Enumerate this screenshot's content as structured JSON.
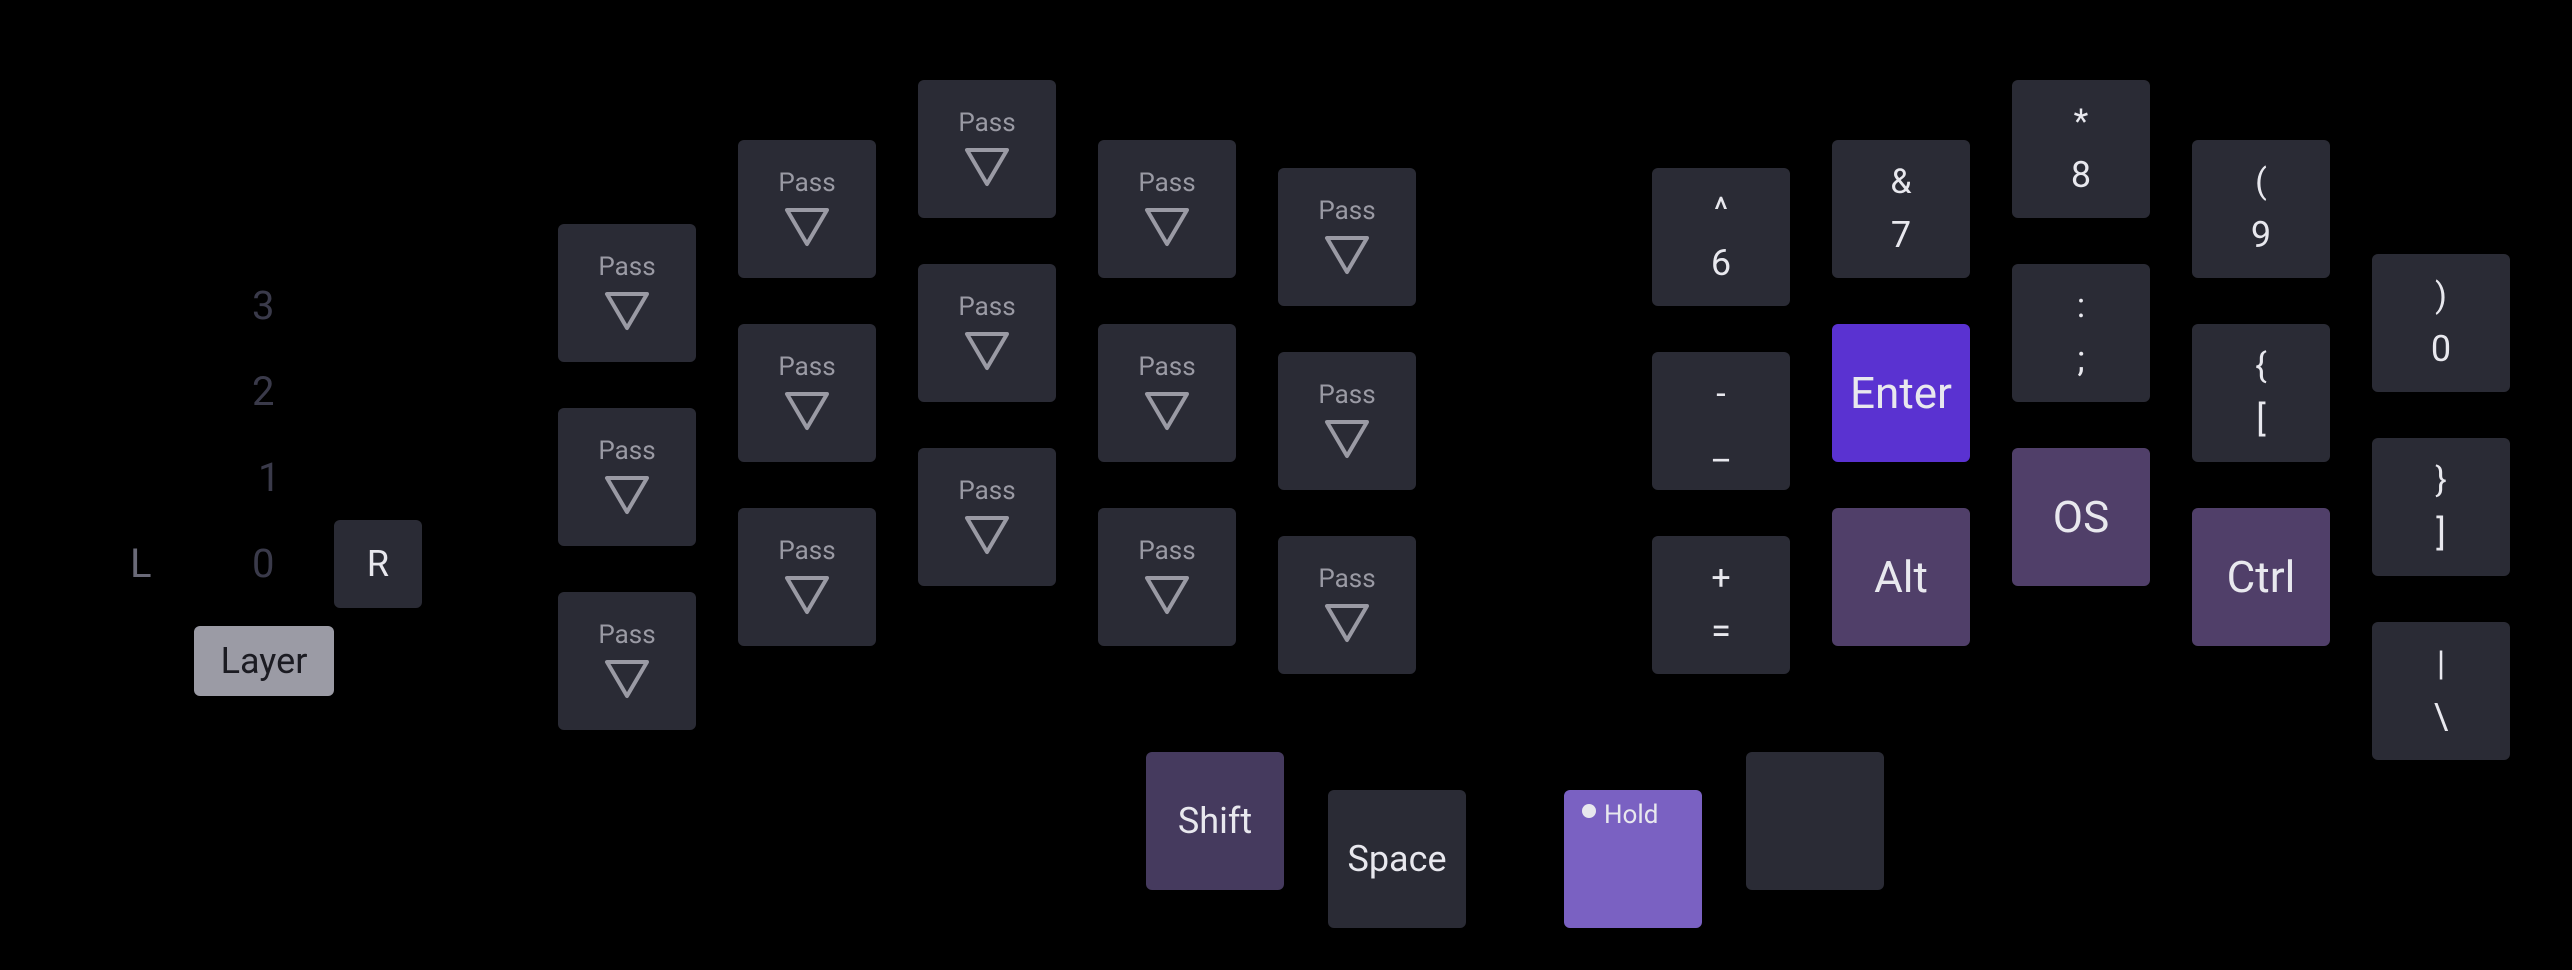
{
  "layer_picker": {
    "nums": [
      "3",
      "2",
      "1",
      "0"
    ],
    "side_L": "L",
    "side_R": "R",
    "layer_label": "Layer"
  },
  "pass_label": "Pass",
  "thumbs": {
    "shift": "Shift",
    "space": "Space",
    "hold": "Hold"
  },
  "right": {
    "c1r1": {
      "top": "^",
      "bot": "6"
    },
    "c1r2": {
      "top": "-",
      "bot": "_"
    },
    "c1r3": {
      "top": "+",
      "bot": "="
    },
    "c2r1": {
      "top": "&",
      "bot": "7"
    },
    "enter": "Enter",
    "alt": "Alt",
    "c3r1": {
      "top": "*",
      "bot": "8"
    },
    "c3r2": {
      "top": ":",
      "bot": ";"
    },
    "os": "OS",
    "c4r1": {
      "top": "(",
      "bot": "9"
    },
    "c4r2": {
      "top": "{",
      "bot": "["
    },
    "ctrl": "Ctrl",
    "c5r1": {
      "top": ")",
      "bot": "0"
    },
    "c5r2": {
      "top": "}",
      "bot": "]"
    },
    "c5r3": {
      "top": "|",
      "bot": "\\"
    }
  }
}
